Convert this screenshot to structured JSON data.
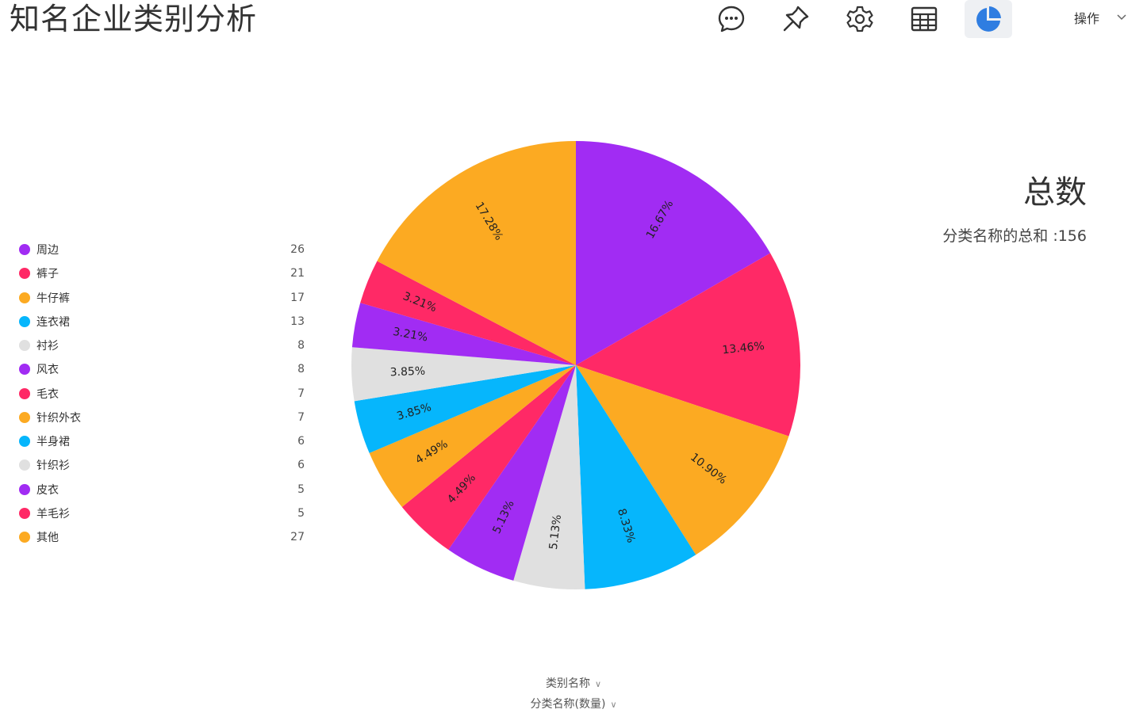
{
  "header": {
    "title": "知名企业类别分析",
    "ops_label": "操作"
  },
  "toolbar": {
    "icons": [
      "comment-icon",
      "pin-icon",
      "settings-icon",
      "table-icon",
      "pie-chart-icon"
    ],
    "active": "pie-chart-icon",
    "accent": "#2f7de1"
  },
  "summary": {
    "title": "总数",
    "line": "分类名称的总和 :156"
  },
  "axis": {
    "category": "类别名称",
    "value": "分类名称(数量)"
  },
  "chart_data": {
    "type": "pie",
    "total": 156,
    "categories": [
      "周边",
      "裤子",
      "牛仔裤",
      "连衣裙",
      "衬衫",
      "风衣",
      "毛衣",
      "针织外衣",
      "半身裙",
      "针织衫",
      "皮衣",
      "羊毛衫",
      "其他"
    ],
    "values": [
      26,
      21,
      17,
      13,
      8,
      8,
      7,
      7,
      6,
      6,
      5,
      5,
      27
    ],
    "percent_labels": [
      "16.67%",
      "13.46%",
      "10.90%",
      "8.33%",
      "5.13%",
      "5.13%",
      "4.49%",
      "4.49%",
      "3.85%",
      "3.85%",
      "3.21%",
      "3.21%",
      "17.28%"
    ],
    "colors": [
      "#a12cf3",
      "#ff2966",
      "#fcaa22",
      "#06b6fc",
      "#e0e0e0",
      "#a12cf3",
      "#ff2966",
      "#fcaa22",
      "#06b6fc",
      "#e0e0e0",
      "#a12cf3",
      "#ff2966",
      "#fcaa22"
    ],
    "legend_position": "left",
    "start_angle": "12 o'clock, clockwise"
  }
}
